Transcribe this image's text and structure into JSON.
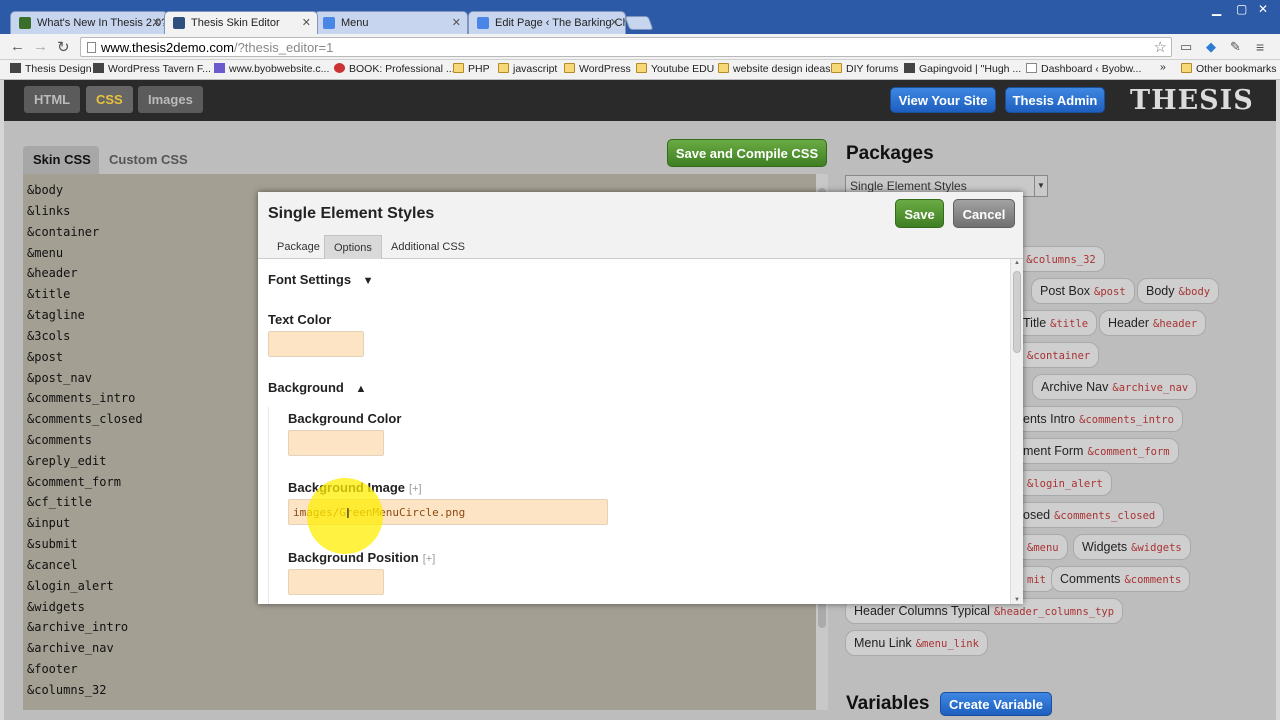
{
  "browser": {
    "tabs": [
      {
        "title": "What's New In Thesis 2.0?",
        "favicon_color": "#3a6f2a"
      },
      {
        "title": "Thesis Skin Editor",
        "favicon_color": "#2f4f7f"
      },
      {
        "title": "Menu",
        "favicon_color": "#4a86e8"
      },
      {
        "title": "Edit Page ‹ The Barking Ch",
        "favicon_color": "#4a86e8"
      }
    ],
    "url_host": "www.thesis2demo.com",
    "url_path": "/?thesis_editor=1",
    "bookmarks": [
      "Thesis Design",
      "WordPress Tavern F...",
      "www.byobwebsite.c...",
      "BOOK: Professional ...",
      "PHP",
      "javascript",
      "WordPress",
      "Youtube EDU",
      "website design ideas",
      "DIY forums",
      "Gapingvoid | \"Hugh ...",
      "Dashboard ‹ Byobw...",
      "Other bookmarks"
    ]
  },
  "thesis": {
    "nav": [
      "HTML",
      "CSS",
      "Images"
    ],
    "active_nav": "CSS",
    "view_site": "View Your Site",
    "admin": "Thesis Admin",
    "logo": "THESIS",
    "accent": "#e8c23a"
  },
  "editor": {
    "tabs": [
      "Skin CSS",
      "Custom CSS"
    ],
    "save_compile": "Save and Compile CSS",
    "css_items": [
      "&body",
      "&links",
      "&container",
      "&menu",
      "&header",
      "&title",
      "&tagline",
      "&3cols",
      "&post",
      "&post_nav",
      "&comments_intro",
      "&comments_closed",
      "&comments",
      "&reply_edit",
      "&comment_form",
      "&cf_title",
      "&input",
      "&submit",
      "&cancel",
      "&login_alert",
      "&widgets",
      "&archive_intro",
      "&archive_nav",
      "&footer",
      "&columns_32"
    ]
  },
  "packages": {
    "title": "Packages",
    "select_value": "Single Element Styles",
    "pills": [
      {
        "label": "ns",
        "ref": "&columns_32"
      },
      {
        "label": "Post Box",
        "ref": "&post"
      },
      {
        "label": "Body",
        "ref": "&body"
      },
      {
        "label": "Title",
        "ref": "&title"
      },
      {
        "label": "Header",
        "ref": "&header"
      },
      {
        "label": "",
        "ref": "&container"
      },
      {
        "label": "Archive Nav",
        "ref": "&archive_nav"
      },
      {
        "label": "ents Intro",
        "ref": "&comments_intro"
      },
      {
        "label": "ment Form",
        "ref": "&comment_form"
      },
      {
        "label": "",
        "ref": "&login_alert"
      },
      {
        "label": "osed",
        "ref": "&comments_closed"
      },
      {
        "label": "",
        "ref": "&menu"
      },
      {
        "label": "Widgets",
        "ref": "&widgets"
      },
      {
        "label": "",
        "ref": "mit"
      },
      {
        "label": "Comments",
        "ref": "&comments"
      },
      {
        "label": "Header Columns Typical",
        "ref": "&header_columns_typ"
      },
      {
        "label": "Menu Link",
        "ref": "&menu_link"
      }
    ],
    "variables_title": "Variables",
    "create_variable": "Create Variable"
  },
  "modal": {
    "title": "Single Element Styles",
    "save": "Save",
    "cancel": "Cancel",
    "tabs": [
      "Package",
      "Options",
      "Additional CSS"
    ],
    "active_tab": "Options",
    "font_settings": "Font Settings",
    "font_toggle": "▼",
    "text_color_label": "Text Color",
    "text_color_value": "",
    "background": "Background",
    "background_toggle": "▲",
    "bg_color_label": "Background Color",
    "bg_color_value": "",
    "bg_image_label": "Background Image",
    "bg_image_value": "images/GreenMenuCircle.png",
    "bg_position_label": "Background Position",
    "bg_position_value": "",
    "plus": "[+]"
  }
}
